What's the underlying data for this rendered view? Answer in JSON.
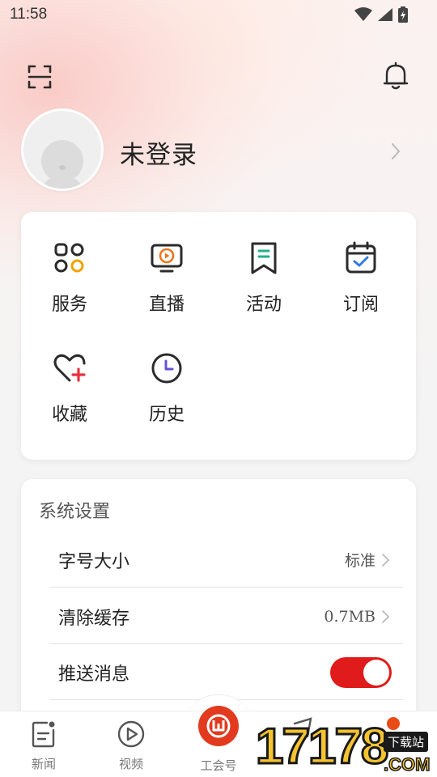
{
  "status_bar": {
    "time": "11:58"
  },
  "profile": {
    "login_text": "未登录"
  },
  "menu": {
    "items": [
      {
        "label": "服务",
        "icon": "services-grid-icon"
      },
      {
        "label": "直播",
        "icon": "live-tv-icon"
      },
      {
        "label": "活动",
        "icon": "activity-bookmark-icon"
      },
      {
        "label": "订阅",
        "icon": "subscribe-calendar-icon"
      },
      {
        "label": "收藏",
        "icon": "favorite-heart-plus-icon"
      },
      {
        "label": "历史",
        "icon": "history-clock-icon"
      }
    ]
  },
  "settings": {
    "title": "系统设置",
    "font_size": {
      "label": "字号大小",
      "value": "标准"
    },
    "clear_cache": {
      "label": "清除缓存",
      "value": "0.7MB"
    },
    "push": {
      "label": "推送消息",
      "enabled": true
    }
  },
  "tabbar": {
    "tabs": [
      {
        "label": "新闻",
        "icon": "news-icon"
      },
      {
        "label": "视频",
        "icon": "video-play-icon"
      },
      {
        "label": "工会号",
        "icon": "union-logo-icon"
      }
    ]
  },
  "watermark": {
    "number": "17178",
    "tag": "下载站",
    "domain": ".COM"
  },
  "colors": {
    "accent": "#e01b1b",
    "brand_orange": "#e23a1e",
    "icon_stroke": "#2b2b2b"
  }
}
